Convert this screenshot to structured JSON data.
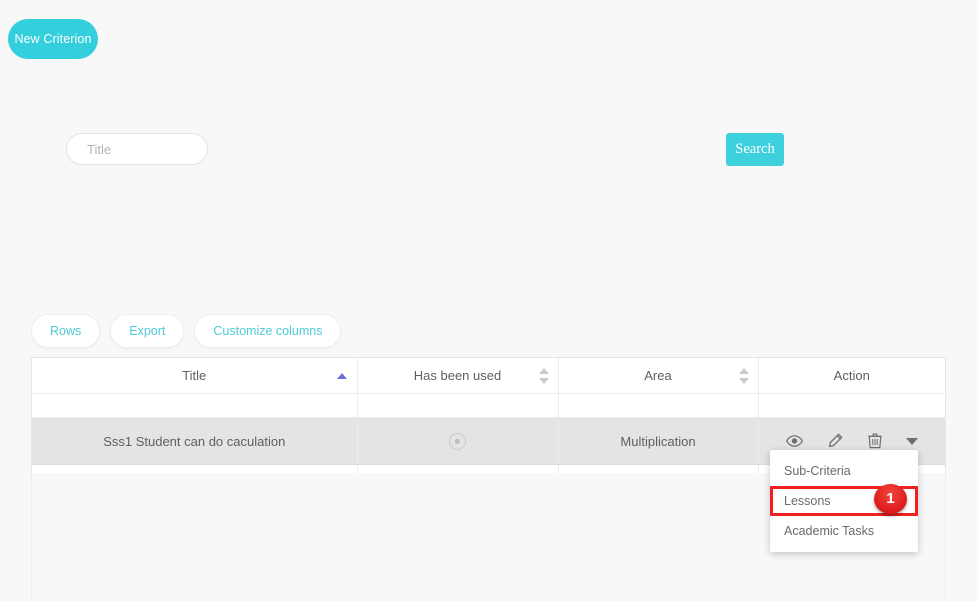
{
  "page": {
    "new_criterion_label": "New Criterion"
  },
  "search": {
    "title_placeholder": "Title",
    "title_value": "",
    "search_label": "Search"
  },
  "toolbar": {
    "rows_label": "Rows",
    "export_label": "Export",
    "customize_columns_label": "Customize columns"
  },
  "table": {
    "columns": [
      {
        "label": "Title",
        "sort": "asc"
      },
      {
        "label": "Has been used",
        "sort": "both"
      },
      {
        "label": "Area",
        "sort": "both"
      },
      {
        "label": "Action",
        "sort": "none"
      }
    ],
    "rows": [
      {
        "title": "Sss1 Student can do caculation",
        "has_been_used": "used-dot-icon",
        "area": "Multiplication",
        "actions": [
          "eye-icon",
          "pencil-icon",
          "trash-icon",
          "caret-down-icon"
        ]
      }
    ]
  },
  "dropdown": {
    "items": [
      {
        "label": "Sub-Criteria",
        "highlighted": false
      },
      {
        "label": "Lessons",
        "highlighted": true
      },
      {
        "label": "Academic Tasks",
        "highlighted": false
      }
    ]
  },
  "annotation": {
    "step_number": "1"
  },
  "colors": {
    "accent": "#34cfdd",
    "search_button": "#3fd0dd",
    "pill_text": "#4ecbd9",
    "sort_active": "#6b6fd4",
    "highlight": "#f02020",
    "badge": "#e02020"
  }
}
